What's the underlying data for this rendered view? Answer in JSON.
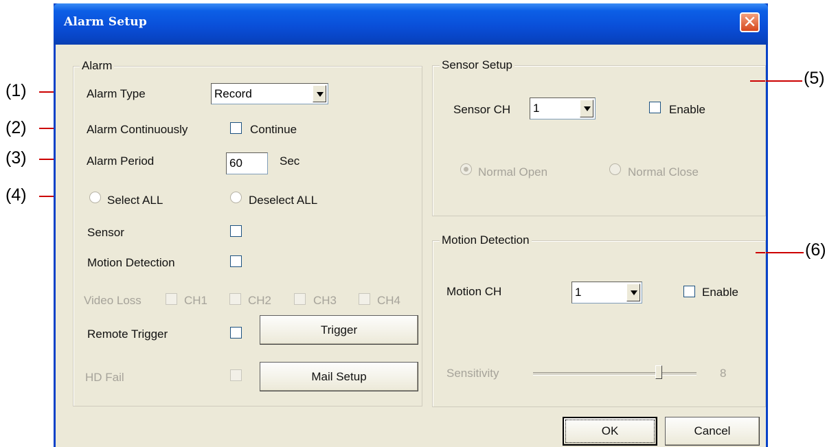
{
  "window": {
    "title": "Alarm Setup",
    "close_glyph": "✕"
  },
  "callouts": {
    "c1": "(1)",
    "c2": "(2)",
    "c3": "(3)",
    "c4": "(4)",
    "c5": "(5)",
    "c6": "(6)",
    "color": "#cc0000"
  },
  "alarm": {
    "group_label": "Alarm",
    "alarm_type_label": "Alarm Type",
    "alarm_type_value": "Record",
    "alarm_continuously_label": "Alarm Continuously",
    "continue_label": "Continue",
    "alarm_period_label": "Alarm Period",
    "alarm_period_value": "60",
    "alarm_period_unit": "Sec",
    "select_all_label": "Select ALL",
    "deselect_all_label": "Deselect ALL",
    "sensor_label": "Sensor",
    "motion_detection_label": "Motion Detection",
    "video_loss_label": "Video Loss",
    "ch1": "CH1",
    "ch2": "CH2",
    "ch3": "CH3",
    "ch4": "CH4",
    "remote_trigger_label": "Remote Trigger",
    "trigger_button": "Trigger",
    "hd_fail_label": "HD Fail",
    "mail_setup_button": "Mail Setup"
  },
  "sensor_setup": {
    "group_label": "Sensor Setup",
    "sensor_ch_label": "Sensor CH",
    "sensor_ch_value": "1",
    "enable_label": "Enable",
    "normal_open_label": "Normal Open",
    "normal_close_label": "Normal Close"
  },
  "motion_detection": {
    "group_label": "Motion Detection",
    "motion_ch_label": "Motion CH",
    "motion_ch_value": "1",
    "enable_label": "Enable",
    "sensitivity_label": "Sensitivity",
    "sensitivity_value": "8"
  },
  "footer": {
    "ok_button": "OK",
    "cancel_button": "Cancel"
  },
  "colors": {
    "title_bar": "#0a4fd9",
    "dialog_bg": "#ece9d8",
    "close_button": "#d6481e"
  }
}
